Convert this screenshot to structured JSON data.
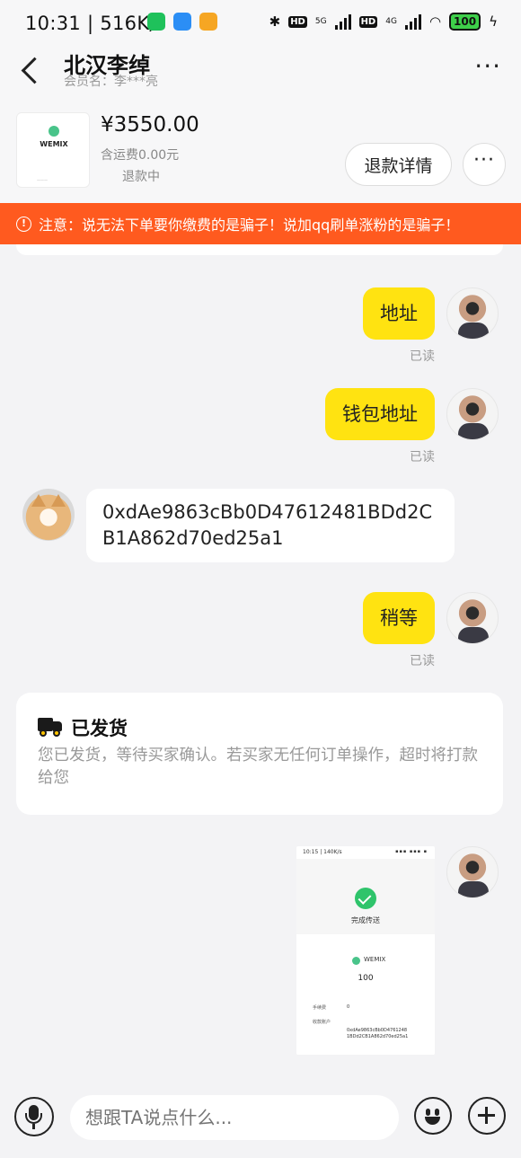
{
  "status_bar": {
    "time": "10:31",
    "net_speed": "516K/s",
    "battery": "100",
    "net_5g": "5G",
    "net_4g": "4G",
    "hd": "HD"
  },
  "header": {
    "title": "北汉李绰",
    "member_name": "会员名：李***亮"
  },
  "order": {
    "product_brand": "WEMIX",
    "price": "¥3550.00",
    "shipping": "含运费0.00元",
    "status": "退款中",
    "refund_button": "退款详情"
  },
  "warning": {
    "text": "注意：说无法下单要你缴费的是骗子！说加qq刷单涨粉的是骗子！"
  },
  "messages": [
    {
      "from": "me",
      "text": "地址",
      "read": "已读"
    },
    {
      "from": "me",
      "text": "钱包地址",
      "read": "已读"
    },
    {
      "from": "other",
      "text": "0xdAe9863cBb0D47612481BDd2CB1A862d70ed25a1"
    },
    {
      "from": "me",
      "text": "稍等",
      "read": "已读"
    }
  ],
  "notice": {
    "title": "已发货",
    "text": "您已发货，等待买家确认。若买家无任何订单操作，超时将打款给您"
  },
  "image_message": {
    "time": "10:15",
    "speed": "140K/s",
    "done_text": "完成传送",
    "brand": "WEMIX",
    "amount": "100",
    "fee_label": "手续费",
    "fee_value": "0",
    "account_label": "收款账户",
    "account_value": "0xdAe9863cBb0D47612481BDd2CB1A862d70ed25a1"
  },
  "input": {
    "placeholder": "想跟TA说点什么..."
  },
  "colors": {
    "accent_yellow": "#ffe311",
    "warning_orange": "#ff5a1f",
    "wemix_green": "#49c48a"
  },
  "icons": [
    "back-icon",
    "more-icon",
    "warning-icon",
    "truck-icon",
    "check-icon",
    "mic-icon",
    "emoji-icon",
    "plus-icon"
  ]
}
